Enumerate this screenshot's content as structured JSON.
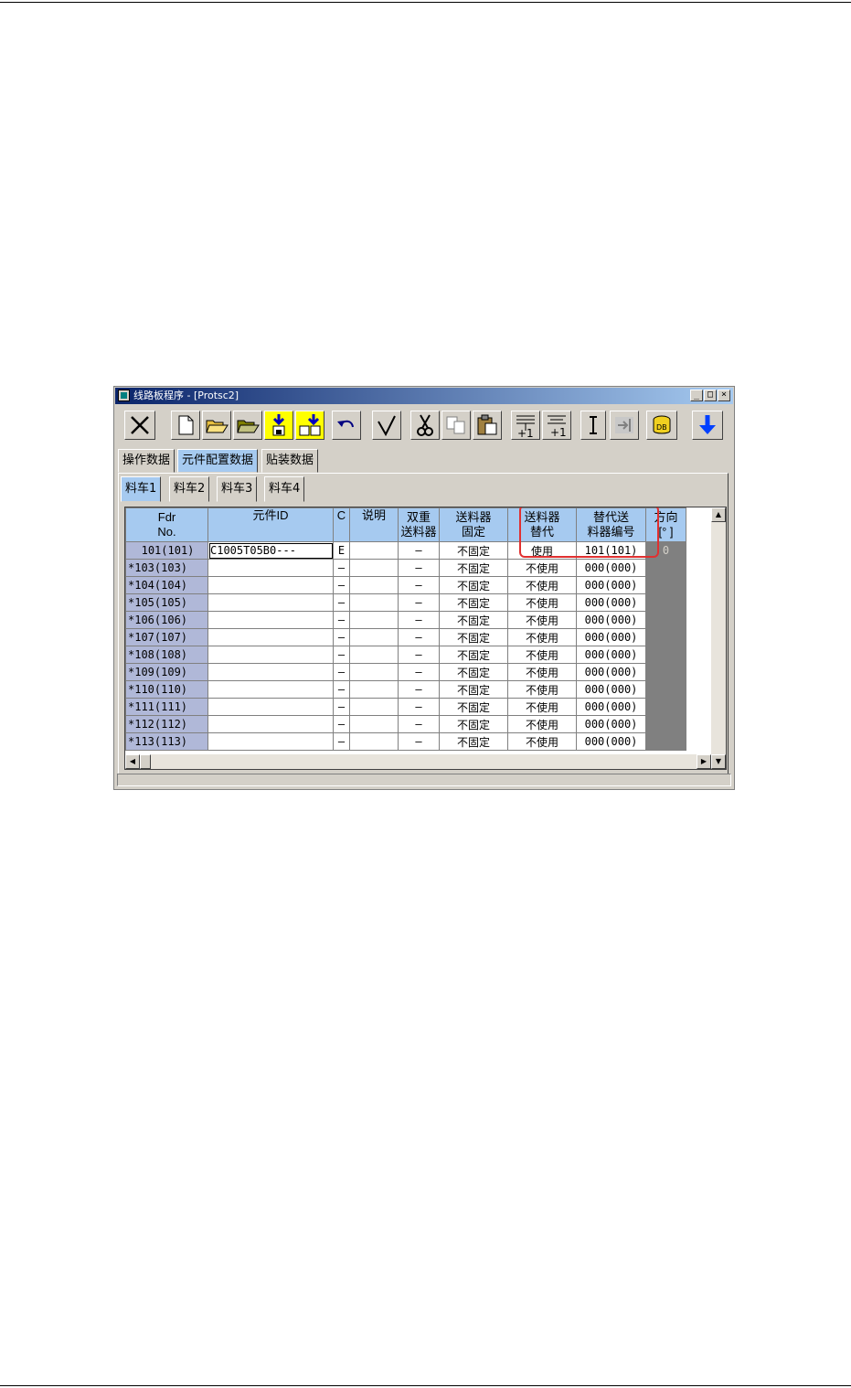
{
  "window": {
    "title": "线路板程序 - [Protsc2]",
    "controls": [
      "_",
      "□",
      "×"
    ]
  },
  "toolbar": {
    "buttons": [
      "close-x",
      "new-file",
      "open-folder",
      "open-folder-2",
      "save-down",
      "save-all-down",
      "undo",
      "check",
      "cut",
      "copy",
      "paste",
      "insert-plus1",
      "insert-plus1-alt",
      "text-cursor",
      "goto-end",
      "db",
      "download-arrow"
    ]
  },
  "main_tabs": [
    "操作数据",
    "元件配置数据",
    "贴装数据"
  ],
  "sub_tabs": [
    "料车1",
    "料车2",
    "料车3",
    "料车4"
  ],
  "grid": {
    "headers": {
      "fdr": "Fdr\nNo.",
      "part_id": "元件ID",
      "c": "C",
      "desc": "说明",
      "dual": "双重\n送料器",
      "fixed": "送料器\n固定",
      "alt": "送料器\n替代",
      "alt_no": "替代送\n料器编号",
      "dir": "方向\n[° ]"
    },
    "rows": [
      {
        "fdr": "101(101)",
        "part_id": "C1005T05B0---",
        "c": "E",
        "desc": "",
        "dual": "–",
        "fixed": "不固定",
        "alt": "使用",
        "alt_no": "101(101)",
        "dir": "0"
      },
      {
        "fdr": "*103(103)",
        "part_id": "",
        "c": "–",
        "desc": "",
        "dual": "–",
        "fixed": "不固定",
        "alt": "不使用",
        "alt_no": "000(000)",
        "dir": ""
      },
      {
        "fdr": "*104(104)",
        "part_id": "",
        "c": "–",
        "desc": "",
        "dual": "–",
        "fixed": "不固定",
        "alt": "不使用",
        "alt_no": "000(000)",
        "dir": ""
      },
      {
        "fdr": "*105(105)",
        "part_id": "",
        "c": "–",
        "desc": "",
        "dual": "–",
        "fixed": "不固定",
        "alt": "不使用",
        "alt_no": "000(000)",
        "dir": ""
      },
      {
        "fdr": "*106(106)",
        "part_id": "",
        "c": "–",
        "desc": "",
        "dual": "–",
        "fixed": "不固定",
        "alt": "不使用",
        "alt_no": "000(000)",
        "dir": ""
      },
      {
        "fdr": "*107(107)",
        "part_id": "",
        "c": "–",
        "desc": "",
        "dual": "–",
        "fixed": "不固定",
        "alt": "不使用",
        "alt_no": "000(000)",
        "dir": ""
      },
      {
        "fdr": "*108(108)",
        "part_id": "",
        "c": "–",
        "desc": "",
        "dual": "–",
        "fixed": "不固定",
        "alt": "不使用",
        "alt_no": "000(000)",
        "dir": ""
      },
      {
        "fdr": "*109(109)",
        "part_id": "",
        "c": "–",
        "desc": "",
        "dual": "–",
        "fixed": "不固定",
        "alt": "不使用",
        "alt_no": "000(000)",
        "dir": ""
      },
      {
        "fdr": "*110(110)",
        "part_id": "",
        "c": "–",
        "desc": "",
        "dual": "–",
        "fixed": "不固定",
        "alt": "不使用",
        "alt_no": "000(000)",
        "dir": ""
      },
      {
        "fdr": "*111(111)",
        "part_id": "",
        "c": "–",
        "desc": "",
        "dual": "–",
        "fixed": "不固定",
        "alt": "不使用",
        "alt_no": "000(000)",
        "dir": ""
      },
      {
        "fdr": "*112(112)",
        "part_id": "",
        "c": "–",
        "desc": "",
        "dual": "–",
        "fixed": "不固定",
        "alt": "不使用",
        "alt_no": "000(000)",
        "dir": ""
      },
      {
        "fdr": "*113(113)",
        "part_id": "",
        "c": "–",
        "desc": "",
        "dual": "–",
        "fixed": "不固定",
        "alt": "不使用",
        "alt_no": "000(000)",
        "dir": ""
      }
    ]
  },
  "colors": {
    "header_bg": "#a6caf0",
    "fdr_bg": "#b0b8d8",
    "highlight_border": "#e03030",
    "face": "#d4d0c8"
  }
}
